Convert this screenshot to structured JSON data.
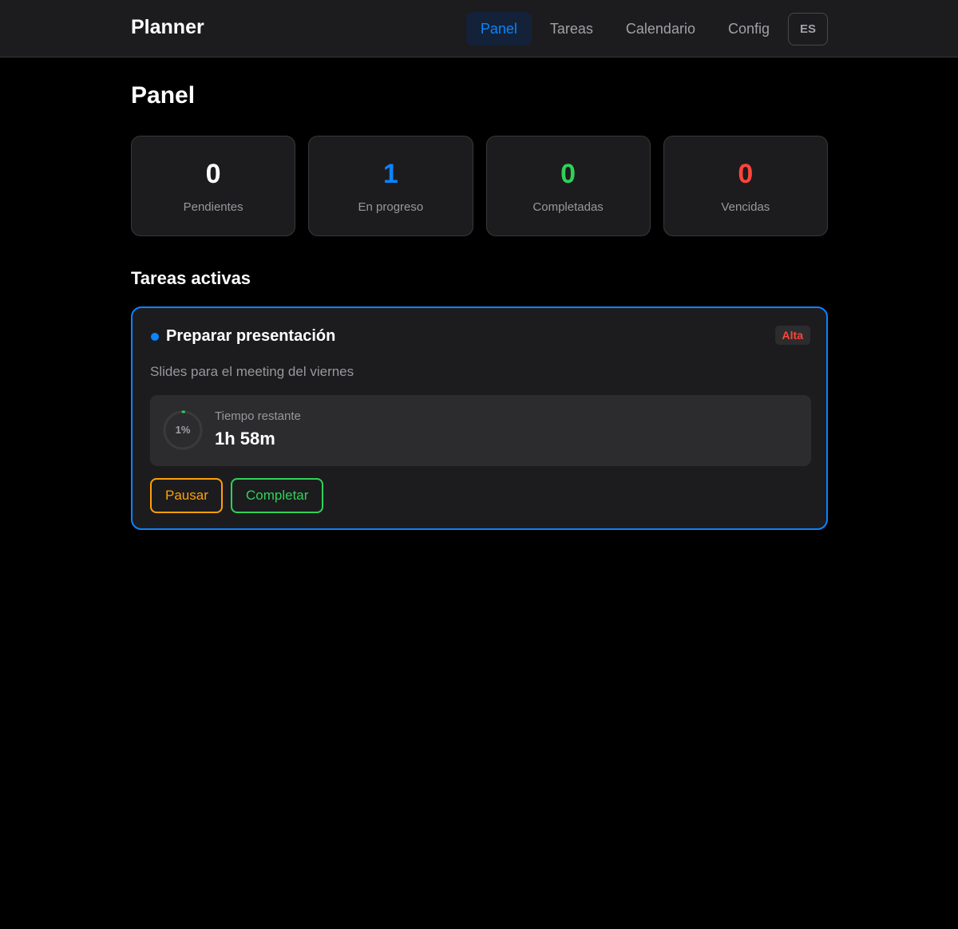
{
  "header": {
    "brand": "Planner",
    "nav": [
      {
        "label": "Panel",
        "active": true
      },
      {
        "label": "Tareas",
        "active": false
      },
      {
        "label": "Calendario",
        "active": false
      },
      {
        "label": "Config",
        "active": false
      }
    ],
    "language": "ES"
  },
  "page": {
    "title": "Panel"
  },
  "stats": [
    {
      "value": "0",
      "label": "Pendientes",
      "color": "#ffffff"
    },
    {
      "value": "1",
      "label": "En progreso",
      "color": "#0a84ff"
    },
    {
      "value": "0",
      "label": "Completadas",
      "color": "#30d158"
    },
    {
      "value": "0",
      "label": "Vencidas",
      "color": "#ff453a"
    }
  ],
  "active_tasks": {
    "title": "Tareas activas",
    "tasks": [
      {
        "title": "Preparar presentación",
        "priority": "Alta",
        "description": "Slides para el meeting del viernes",
        "progress_label": "1%",
        "progress_fraction": 0.01,
        "time_label": "Tiempo restante",
        "time_value": "1h 58m",
        "pause_label": "Pausar",
        "complete_label": "Completar"
      }
    ]
  },
  "colors": {
    "accent": "#0a84ff",
    "success": "#30d158",
    "warning": "#ff9f0a",
    "danger": "#ff453a"
  }
}
